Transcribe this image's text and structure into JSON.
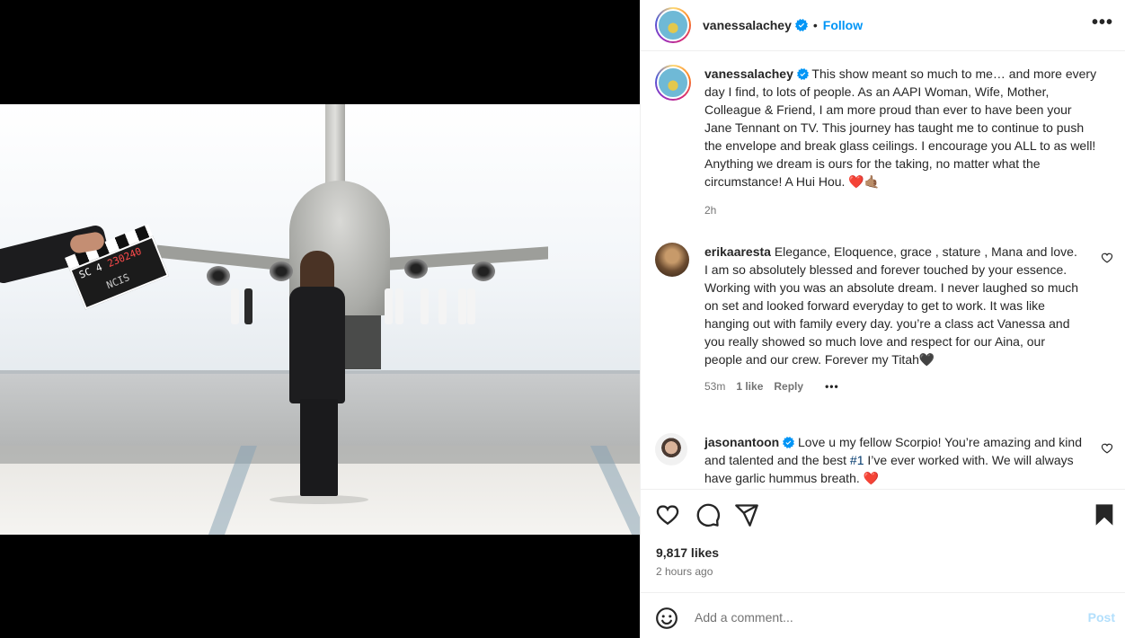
{
  "post": {
    "username": "vanessalachey",
    "follow_label": "Follow",
    "separator": "•",
    "more_label": "•••"
  },
  "caption": {
    "username": "vanessalachey",
    "text": "This show meant so much to me… and more every day I find, to lots of people. As an AAPI Woman, Wife, Mother, Colleague & Friend, I am more proud than ever to have been your Jane Tennant on TV. This journey has taught me to continue to push the envelope and break glass ceilings. I encourage you ALL to as well! Anything we dream is ours for the taking, no matter what the circumstance! A Hui Hou. ❤️🤙🏽",
    "age": "2h"
  },
  "comments": [
    {
      "username": "erikaaresta",
      "text": "Elegance, Eloquence, grace , stature , Mana and love. I am so absolutely blessed and forever touched by your essence. Working with you was an absolute dream. I never laughed so much on set and looked forward everyday to get to work. It was like hanging out with family every day. you’re a class act Vanessa and you really showed so much love and respect for our Aina, our people and our crew. Forever my Titah🖤",
      "age": "53m",
      "likes": "1 like",
      "reply": "Reply",
      "more": "•••"
    },
    {
      "username": "jasonantoon",
      "text_before": "Love u my fellow Scorpio! You’re amazing and kind and talented and the best ",
      "hashtag": "#1",
      "text_after": " I’ve ever worked with. We will always have garlic hummus breath. ❤️"
    }
  ],
  "clapper": {
    "roll": "SC 4",
    "code": "230240",
    "brand": "NCIS"
  },
  "engagement": {
    "likes": "9,817 likes",
    "time": "2 hours ago"
  },
  "composer": {
    "placeholder": "Add a comment...",
    "post_label": "Post"
  },
  "icons": [
    "heart-icon",
    "comment-icon",
    "share-icon",
    "bookmark-icon",
    "emoji-icon",
    "verified-icon",
    "more-icon"
  ],
  "colors": {
    "accent": "#0095f6",
    "verified": "#0095f6",
    "text": "#262626",
    "muted": "#737373",
    "post_disabled": "#b2dffc"
  }
}
